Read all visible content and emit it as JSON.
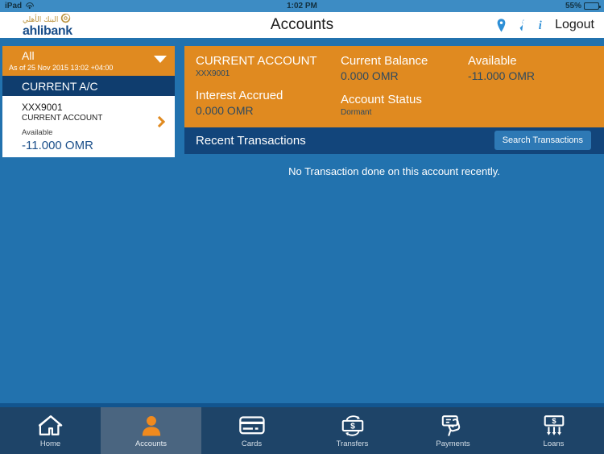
{
  "status_bar": {
    "device": "iPad",
    "wifi_icon": "wifi-icon",
    "time": "1:02 PM",
    "battery_percent": "55%",
    "battery_icon": "battery-icon"
  },
  "header": {
    "logo_arabic": "البنك الأهلي",
    "logo_name": "ahlibank",
    "logo_swirl_icon": "swirl-logo-icon",
    "title": "Accounts",
    "location_icon": "location-pin-icon",
    "phone_icon": "phone-icon",
    "info_icon": "info-icon",
    "logout_label": "Logout"
  },
  "sidebar": {
    "filter": {
      "label": "All",
      "as_of": "As of 25 Nov 2015 13:02 +04:00",
      "caret_icon": "chevron-down-icon"
    },
    "group_header": "CURRENT A/C",
    "account": {
      "number": "XXX9001",
      "type": "CURRENT ACCOUNT",
      "available_label": "Available",
      "available_amount": "-11.000 OMR",
      "chevron_icon": "chevron-right-icon"
    }
  },
  "main": {
    "summary": {
      "account_name": "CURRENT ACCOUNT",
      "account_number": "XXX9001",
      "interest_accrued_label": "Interest Accrued",
      "interest_accrued_value": "0.000 OMR",
      "current_balance_label": "Current Balance",
      "current_balance_value": "0.000 OMR",
      "account_status_label": "Account Status",
      "account_status_value": "Dormant",
      "available_label": "Available",
      "available_value": "-11.000 OMR"
    },
    "transactions": {
      "title": "Recent Transactions",
      "search_button": "Search Transactions",
      "empty_message": "No Transaction done on this account recently."
    }
  },
  "navbar": {
    "items": [
      {
        "label": "Home",
        "icon": "home-icon",
        "active": false
      },
      {
        "label": "Accounts",
        "icon": "person-icon",
        "active": true
      },
      {
        "label": "Cards",
        "icon": "credit-card-icon",
        "active": false
      },
      {
        "label": "Transfers",
        "icon": "transfer-money-icon",
        "active": false
      },
      {
        "label": "Payments",
        "icon": "hand-card-payment-icon",
        "active": false
      },
      {
        "label": "Loans",
        "icon": "loan-money-icon",
        "active": false
      }
    ]
  },
  "colors": {
    "brand_orange": "#E08A20",
    "brand_blue": "#2272AE",
    "dark_navy": "#0F3D6E",
    "nav_bg": "#1E4468",
    "nav_active": "#4A6580",
    "accent_icon_blue": "#2E8FD6"
  }
}
